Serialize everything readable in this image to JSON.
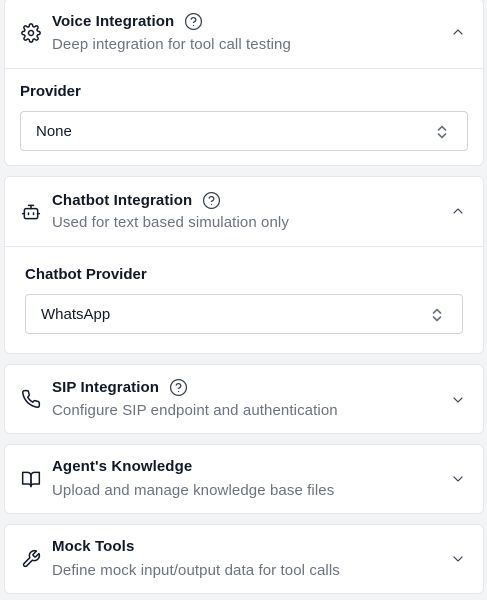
{
  "sections": {
    "voice": {
      "title": "Voice Integration",
      "subtitle": "Deep integration for tool call testing",
      "icon": "gear-icon",
      "expanded": true,
      "field_label": "Provider",
      "field_value": "None"
    },
    "chatbot": {
      "title": "Chatbot Integration",
      "subtitle": "Used for text based simulation only",
      "icon": "bot-icon",
      "expanded": true,
      "field_label": "Chatbot Provider",
      "field_value": "WhatsApp"
    },
    "sip": {
      "title": "SIP Integration",
      "subtitle": "Configure SIP endpoint and authentication",
      "icon": "phone-icon",
      "expanded": false
    },
    "knowledge": {
      "title": "Agent's Knowledge",
      "subtitle": "Upload and manage knowledge base files",
      "icon": "book-icon",
      "expanded": false
    },
    "mock": {
      "title": "Mock Tools",
      "subtitle": "Define mock input/output data for tool calls",
      "icon": "wrench-icon",
      "expanded": false
    }
  },
  "colors": {
    "background": "#f3f4f6",
    "card": "#ffffff",
    "border": "#e5e7eb",
    "text": "#111827",
    "muted": "#6b7280"
  }
}
